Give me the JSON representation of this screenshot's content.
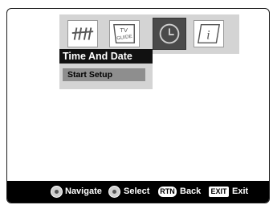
{
  "tabs": [
    {
      "id": "antenna",
      "icon": "antenna-icon",
      "selected": false
    },
    {
      "id": "tv-guide",
      "icon": "tv-guide-icon",
      "label_line1": "TV",
      "label_line2": "GUIDE",
      "selected": false
    },
    {
      "id": "clock",
      "icon": "clock-icon",
      "selected": true
    },
    {
      "id": "info",
      "icon": "info-icon",
      "label": "i",
      "selected": false
    }
  ],
  "menu": {
    "title": "Time And Date",
    "items": [
      {
        "label": "Start Setup",
        "highlighted": true
      }
    ]
  },
  "footer": {
    "navigate_label": "Navigate",
    "select_label": "Select",
    "rtn_key": "RTN",
    "back_label": "Back",
    "exit_key": "EXIT",
    "exit_label": "Exit"
  },
  "colors": {
    "menu_title_bg": "#111111",
    "menu_item_bg": "#8e8e8e",
    "panel_bg": "#d4d4d4",
    "footer_bg": "#000000"
  }
}
